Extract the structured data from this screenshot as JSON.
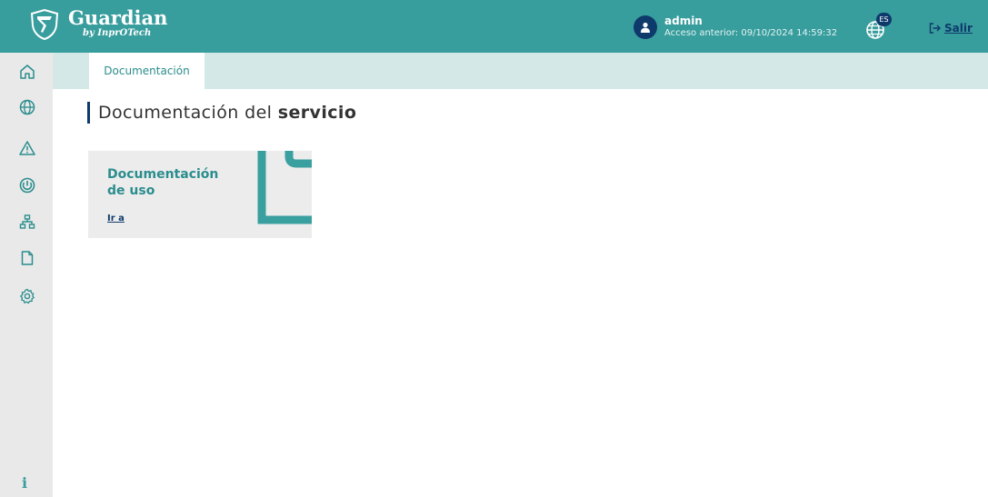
{
  "header": {
    "brand_name": "Guardian",
    "brand_sub": "by InprOTech",
    "user_name": "admin",
    "last_access": "Acceso anterior: 09/10/2024 14:59:32",
    "language_badge": "ES",
    "logout_label": "Salir"
  },
  "sidebar": {
    "items": [
      {
        "icon": "home-icon"
      },
      {
        "icon": "globe-icon"
      },
      {
        "icon": "warning-icon"
      },
      {
        "icon": "radar-icon"
      },
      {
        "icon": "network-icon"
      },
      {
        "icon": "document-icon"
      },
      {
        "icon": "settings-icon"
      }
    ],
    "info_label": "i"
  },
  "tabs": [
    {
      "label": "Documentación",
      "active": true
    }
  ],
  "main": {
    "title_prefix": "Documentación del ",
    "title_bold": "servicio",
    "card": {
      "title": "Documentación de uso",
      "link_label": "Ir a"
    }
  },
  "colors": {
    "header_bg": "#389d9d",
    "accent_dark": "#0e3a6b",
    "sidebar_bg": "#e9e9e9",
    "tabstrip_bg": "#d4e8e7",
    "card_bg": "#ececec"
  }
}
